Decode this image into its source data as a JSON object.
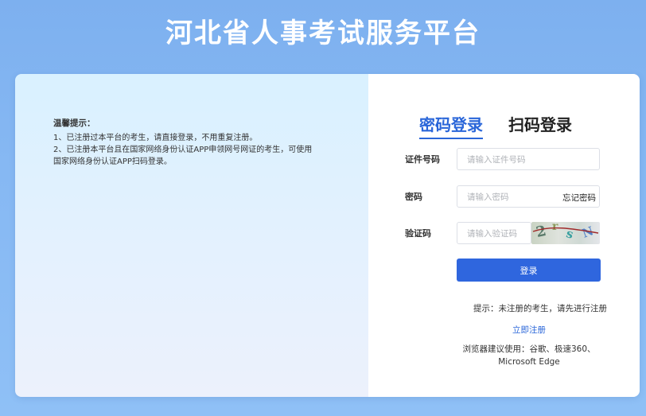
{
  "header": {
    "title": "河北省人事考试服务平台"
  },
  "notice": {
    "title": "温馨提示：",
    "line1": "1、已注册过本平台的考生，请直接登录，不用重复注册。",
    "line2": "2、已注册本平台且在国家网络身份认证APP申领网号网证的考生，可使用国家网络身份认证APP扫码登录。"
  },
  "login": {
    "tabs": [
      {
        "label": "密码登录",
        "active": true
      },
      {
        "label": "扫码登录",
        "active": false
      }
    ],
    "id_label": "证件号码",
    "id_placeholder": "请输入证件号码",
    "password_label": "密码",
    "password_placeholder": "请输入密码",
    "forgot_label": "忘记密码",
    "captcha_label": "验证码",
    "captcha_placeholder": "请输入验证码",
    "captcha_text": "2rsN",
    "submit_label": "登录"
  },
  "footer": {
    "tip": "提示：未注册的考生，请先进行注册",
    "register_link": "立即注册",
    "browser_line1": "浏览器建议使用：谷歌、极速360、",
    "browser_line2": "Microsoft Edge"
  },
  "colors": {
    "accent": "#2f66de",
    "tab_active": "#2a66d9",
    "background": "#86b8f3"
  }
}
